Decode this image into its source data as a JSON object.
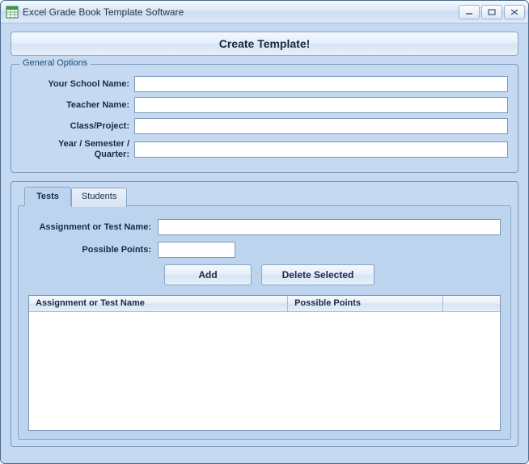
{
  "window": {
    "title": "Excel Grade Book Template Software"
  },
  "buttons": {
    "create": "Create Template!",
    "add": "Add",
    "delete": "Delete Selected"
  },
  "general": {
    "legend": "General Options",
    "schoolLabel": "Your School Name:",
    "schoolValue": "",
    "teacherLabel": "Teacher Name:",
    "teacherValue": "",
    "classLabel": "Class/Project:",
    "classValue": "",
    "yearLabel": "Year / Semester / Quarter:",
    "yearValue": ""
  },
  "tabs": {
    "tests": "Tests",
    "students": "Students"
  },
  "testsPanel": {
    "nameLabel": "Assignment or Test Name:",
    "nameValue": "",
    "pointsLabel": "Possible Points:",
    "pointsValue": "",
    "col1": "Assignment or Test Name",
    "col2": "Possible Points"
  }
}
